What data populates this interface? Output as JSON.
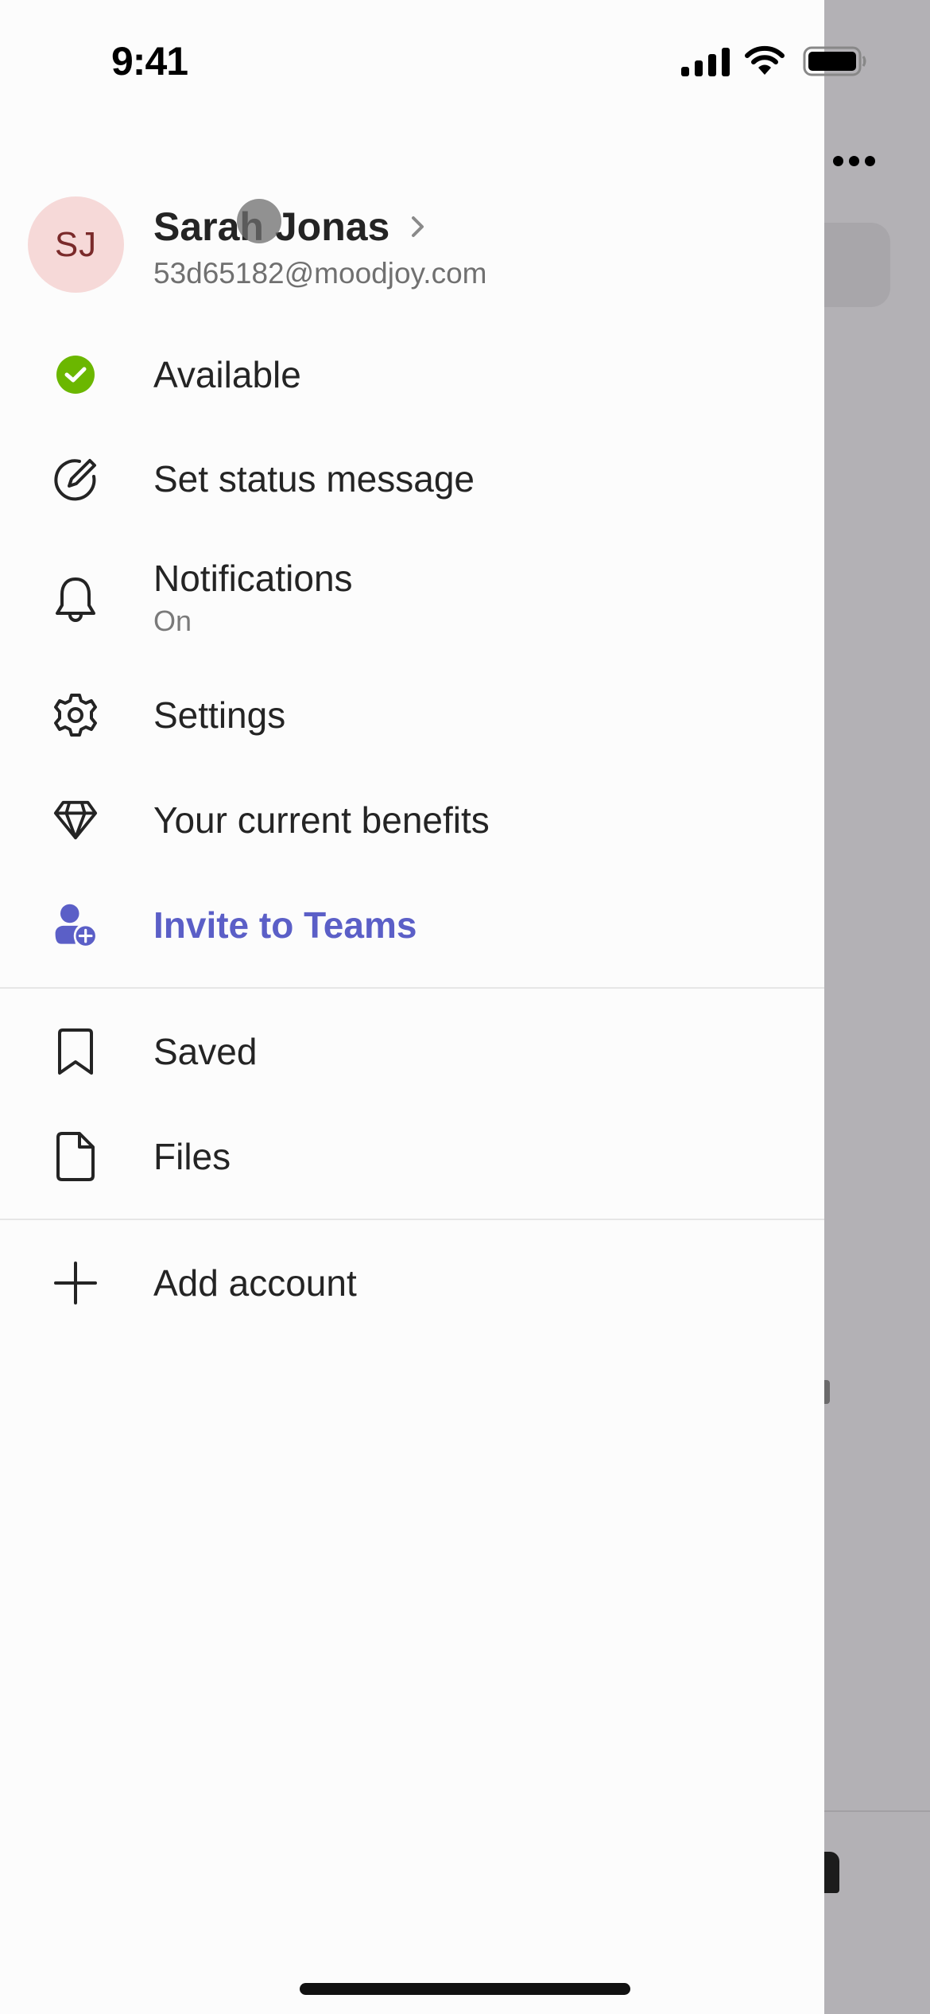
{
  "status_bar": {
    "time": "9:41",
    "icons": [
      "cellular-signal-icon",
      "wifi-icon",
      "battery-icon"
    ]
  },
  "profile": {
    "initials": "SJ",
    "name": "Sarah Jonas",
    "email": "53d65182@moodjoy.com",
    "avatar_bg": "#f6d9d8",
    "avatar_fg": "#7a2a2a"
  },
  "menu": {
    "presence": {
      "label": "Available",
      "icon": "presence-available-icon",
      "color": "#6bb700"
    },
    "status_message": {
      "label": "Set status message",
      "icon": "edit-circle-icon"
    },
    "notifications": {
      "label": "Notifications",
      "sublabel": "On",
      "icon": "bell-icon"
    },
    "settings": {
      "label": "Settings",
      "icon": "gear-icon"
    },
    "benefits": {
      "label": "Your current benefits",
      "icon": "diamond-icon"
    },
    "invite": {
      "label": "Invite to Teams",
      "icon": "person-add-icon",
      "color": "#5b5fc7"
    },
    "saved": {
      "label": "Saved",
      "icon": "bookmark-icon"
    },
    "files": {
      "label": "Files",
      "icon": "file-icon"
    },
    "add_account": {
      "label": "Add account",
      "icon": "plus-icon"
    }
  },
  "background_app": {
    "more_icon": "more-horizontal-icon"
  }
}
